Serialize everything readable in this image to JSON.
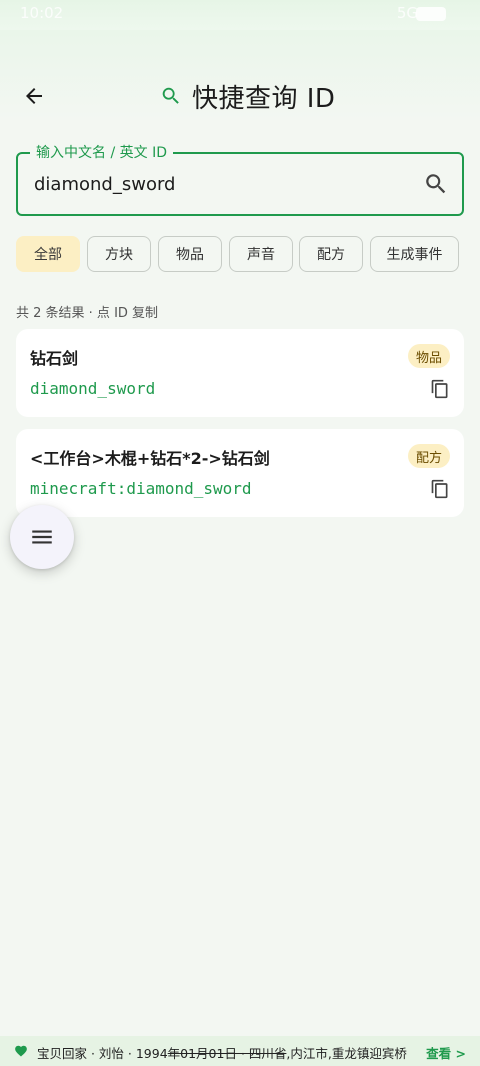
{
  "status_bar": {
    "time": "10:02",
    "signal": "5G"
  },
  "header": {
    "title": "快捷查询 ID"
  },
  "search": {
    "label": "输入中文名 / 英文 ID",
    "value": "diamond_sword"
  },
  "filters": [
    {
      "label": "全部",
      "active": true
    },
    {
      "label": "方块",
      "active": false
    },
    {
      "label": "物品",
      "active": false
    },
    {
      "label": "声音",
      "active": false
    },
    {
      "label": "配方",
      "active": false
    },
    {
      "label": "生成事件",
      "active": false
    }
  ],
  "results_summary": "共 2 条结果 · 点 ID 复制",
  "results": [
    {
      "name": "钻石剑",
      "type": "物品",
      "id": "diamond_sword"
    },
    {
      "name": "<工作台>木棍+钻石*2->钻石剑",
      "type": "配方",
      "id": "minecraft:diamond_sword"
    }
  ],
  "footer": {
    "text_prefix": "宝贝回家 · 刘怡 · 1994",
    "text_strike": "年01月01日 · 四川省",
    "text_suffix": ",内江市,重龙镇迎宾桥",
    "link": "查看 >"
  },
  "colors": {
    "accent": "#1f9a4d",
    "chip_active": "#fcefc4",
    "background": "#f3f7f2"
  },
  "icons": {
    "back": "arrow-left-icon",
    "title": "search-icon",
    "search": "search-icon",
    "copy": "copy-icon",
    "menu": "menu-icon",
    "footer": "heart-icon"
  }
}
